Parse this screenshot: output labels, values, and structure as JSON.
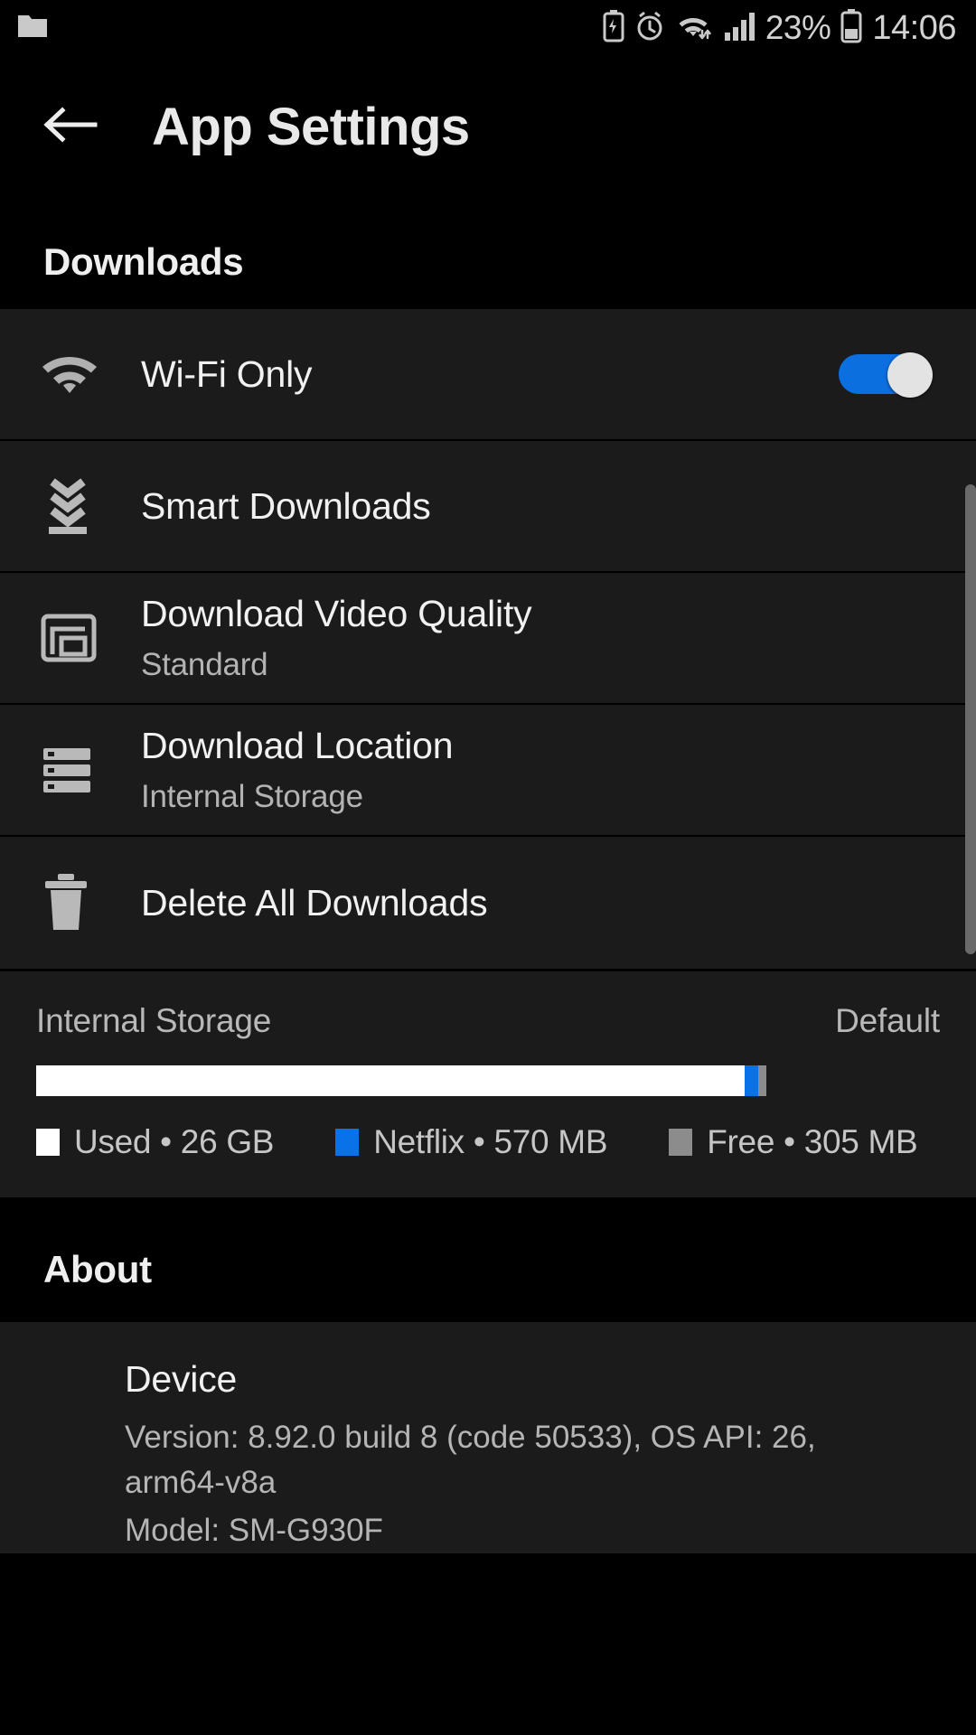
{
  "statusbar": {
    "left_icons": [
      "folder-icon"
    ],
    "right_icons": [
      "battery-saver-icon",
      "alarm-icon",
      "wifi-data-icon",
      "signal-bars-icon"
    ],
    "battery_percent": "23%",
    "time": "14:06"
  },
  "appbar": {
    "back_icon": "back-arrow-icon",
    "title": "App Settings"
  },
  "downloads": {
    "section_title": "Downloads",
    "rows": [
      {
        "icon": "wifi-icon",
        "title": "Wi-Fi Only",
        "subtitle": "",
        "control": "toggle",
        "toggle_on": true
      },
      {
        "icon": "smart-download-icon",
        "title": "Smart Downloads",
        "subtitle": "",
        "control": "none"
      },
      {
        "icon": "video-quality-icon",
        "title": "Download Video Quality",
        "subtitle": "Standard",
        "control": "none"
      },
      {
        "icon": "storage-location-icon",
        "title": "Download Location",
        "subtitle": "Internal Storage",
        "control": "none"
      },
      {
        "icon": "trash-icon",
        "title": "Delete All Downloads",
        "subtitle": "",
        "control": "none"
      }
    ]
  },
  "storage": {
    "label": "Internal Storage",
    "value": "Default",
    "segments": [
      {
        "name": "Used",
        "amount": "26 GB",
        "color": "#ffffff",
        "percent": 97.0
      },
      {
        "name": "Netflix",
        "amount": "570 MB",
        "color": "#0a72e8",
        "percent": 1.9
      },
      {
        "name": "Free",
        "amount": "305 MB",
        "color": "#8c8c8c",
        "percent": 1.1
      }
    ],
    "legend": [
      {
        "text": "Used • 26 GB",
        "color": "#ffffff"
      },
      {
        "text": "Netflix • 570 MB",
        "color": "#0a72e8"
      },
      {
        "text": "Free • 305 MB",
        "color": "#8c8c8c"
      }
    ]
  },
  "about": {
    "section_title": "About",
    "device_title": "Device",
    "version_line": "Version: 8.92.0 build 8 (code 50533), OS API: 26, arm64-v8a",
    "model_line": "Model: SM-G930F"
  },
  "theme": {
    "accent": "#0a72e8",
    "background": "#000000",
    "card": "#1b1b1b",
    "primary_text": "#f1f1f1",
    "secondary_text": "#b3b3b3"
  }
}
